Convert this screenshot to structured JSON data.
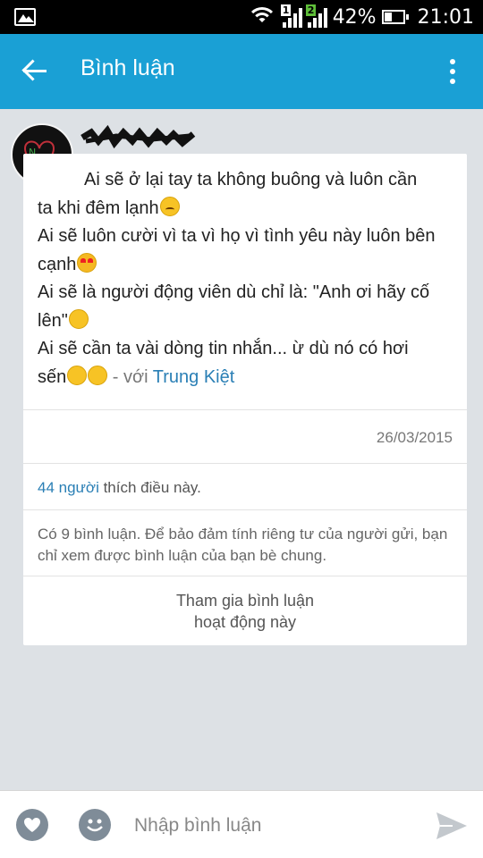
{
  "status_bar": {
    "battery_percent": "42%",
    "battery_level": 0.42,
    "time": "21:01",
    "sim1_label": "1",
    "sim2_label": "2",
    "icons": [
      "gallery-icon",
      "wifi-icon",
      "signal-sim1-icon",
      "signal-sim2-icon",
      "battery-icon"
    ]
  },
  "app_bar": {
    "title": "Bình luận",
    "back_icon": "arrow-left-icon",
    "menu_icon": "more-vertical-icon",
    "color": "#1aa0d5"
  },
  "post": {
    "lines": [
      "Ai sẽ ở lại tay ta không buông và luôn cần",
      "ta khi đêm lạnh",
      "Ai sẽ luôn cười vì ta vì họ vì tình yêu này luôn bên",
      "cạnh",
      "Ai sẽ là người động viên dù chỉ là: \"Anh ơi hãy cố",
      "lên\"",
      "Ai sẽ cần ta vài dòng tin nhắn... ừ dù nó có hơi",
      "sến"
    ],
    "with_prefix": " - với ",
    "tagged_friend": "Trung Kiệt",
    "date": "26/03/2015",
    "likes_count": "44 người",
    "likes_suffix": " thích điều này.",
    "privacy_notice": "Có 9 bình luận. Để bảo đảm tính riêng tư của người gửi, bạn chỉ xem được bình luận của bạn bè chung.",
    "join_line1": "Tham gia bình luận",
    "join_line2": "hoạt động này"
  },
  "composer": {
    "placeholder": "Nhập bình luận",
    "heart_icon": "heart-icon",
    "emoji_icon": "smiley-icon",
    "send_icon": "send-icon"
  },
  "colors": {
    "accent": "#1aa0d5",
    "link": "#2a7fb5",
    "background": "#dde1e5"
  }
}
